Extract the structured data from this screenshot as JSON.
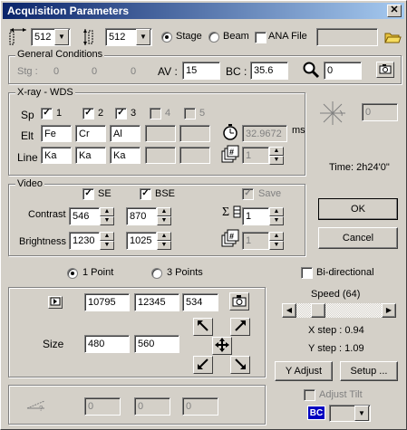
{
  "window": {
    "title": "Acquisition Parameters",
    "close_glyph": "✕"
  },
  "top": {
    "width_value": "512",
    "height_value": "512",
    "mode_options": [
      "Stage",
      "Beam"
    ],
    "mode_selected": "Stage",
    "ana_file_label": "ANA File",
    "ana_file_value": ""
  },
  "general": {
    "title": "General Conditions",
    "stg_label": "Stg :",
    "stg_values": [
      "0",
      "0",
      "0"
    ],
    "av_label": "AV :",
    "av_value": "15",
    "bc_label": "BC :",
    "bc_value": "35.6",
    "mag_value": "0"
  },
  "xray": {
    "title": "X-ray - WDS",
    "sp_label": "Sp",
    "spectrometers": [
      {
        "label": "1",
        "checked": true
      },
      {
        "label": "2",
        "checked": true
      },
      {
        "label": "3",
        "checked": true
      },
      {
        "label": "4",
        "checked": false
      },
      {
        "label": "5",
        "checked": false
      }
    ],
    "elt_label": "Elt",
    "elements": [
      "Fe",
      "Cr",
      "Al",
      "",
      ""
    ],
    "line_label": "Line",
    "lines": [
      "Ka",
      "Ka",
      "Ka",
      "",
      ""
    ],
    "dwell_value": "32.9672",
    "dwell_unit": "ms",
    "accum_value": "1",
    "angle_value": "0",
    "time_text": "Time: 2h24'0\""
  },
  "video": {
    "title": "Video",
    "se_label": "SE",
    "bse_label": "BSE",
    "save_label": "Save",
    "contrast_label": "Contrast",
    "contrast_se": "546",
    "contrast_bse": "870",
    "brightness_label": "Brightness",
    "brightness_se": "1230",
    "brightness_bse": "1025",
    "sum_value": "1",
    "count_value": "1"
  },
  "buttons": {
    "ok": "OK",
    "cancel": "Cancel",
    "y_adjust": "Y Adjust",
    "setup": "Setup ..."
  },
  "points": {
    "one_point": "1 Point",
    "three_points": "3 Points",
    "selected": "1 Point",
    "bidirectional_label": "Bi-directional",
    "pos_values": [
      "10795",
      "12345",
      "534"
    ],
    "size_label": "Size",
    "size_x": "480",
    "size_y": "560"
  },
  "speed": {
    "label": "Speed (64)",
    "level": 0.2,
    "x_step": "X step : 0.94",
    "y_step": "Y step : 1.09"
  },
  "bottom": {
    "values": [
      "0",
      "0",
      "0"
    ],
    "adjust_tilt_label": "Adjust Tilt",
    "bc_badge": "BC"
  }
}
